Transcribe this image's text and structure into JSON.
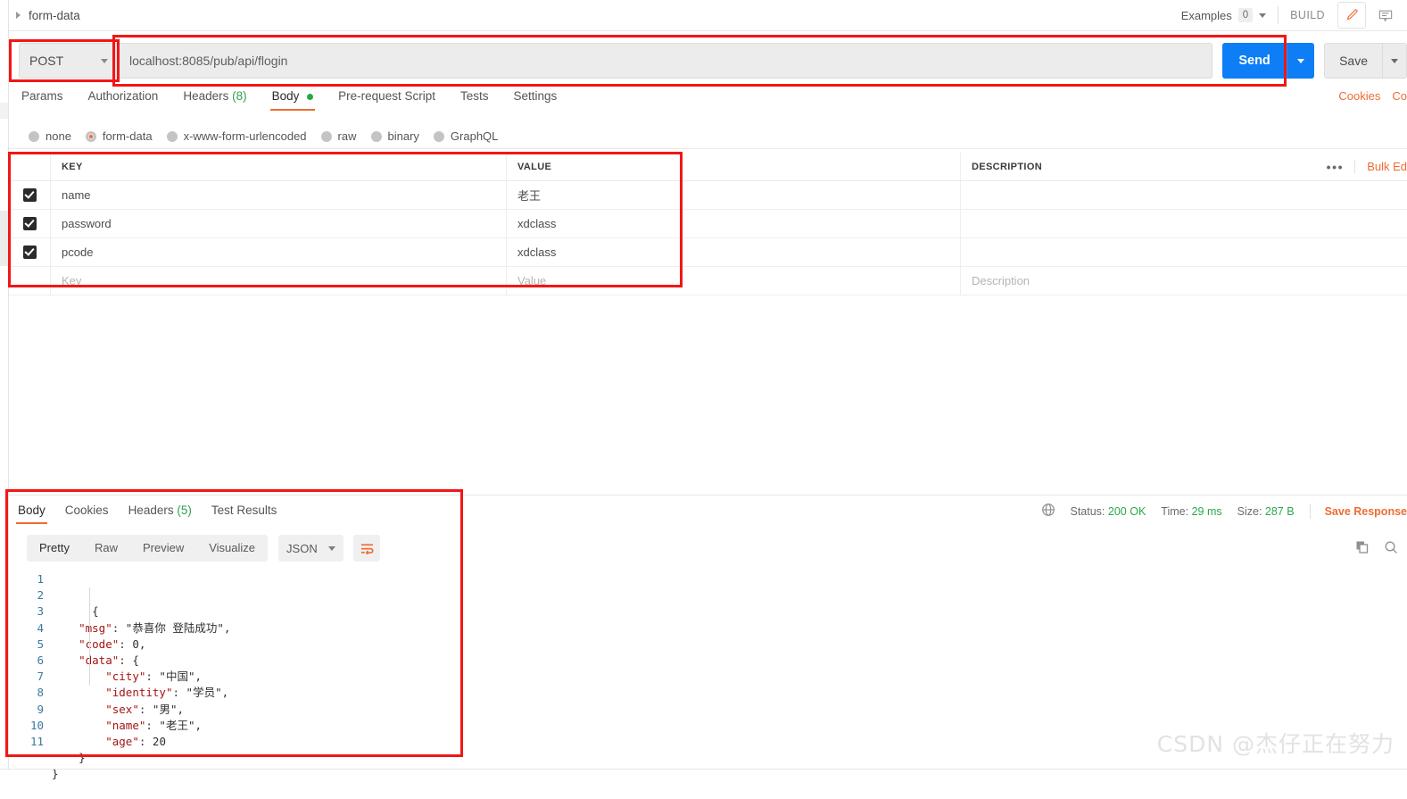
{
  "breadcrumb": {
    "label": "form-data",
    "expand_icon": "triangle-right-icon"
  },
  "topbar": {
    "examples_label": "Examples",
    "examples_count": "0",
    "build_label": "BUILD",
    "edit_icon": "pencil-icon",
    "comment_icon": "comment-icon"
  },
  "request": {
    "method": "POST",
    "url": "localhost:8085/pub/api/flogin",
    "send_label": "Send",
    "save_label": "Save"
  },
  "request_tabs": [
    {
      "label": "Params",
      "suffix": "",
      "active": false
    },
    {
      "label": "Authorization",
      "suffix": "",
      "active": false
    },
    {
      "label": "Headers",
      "suffix": "(8)",
      "active": false
    },
    {
      "label": "Body",
      "suffix": "",
      "active": true,
      "dot": true
    },
    {
      "label": "Pre-request Script",
      "suffix": "",
      "active": false
    },
    {
      "label": "Tests",
      "suffix": "",
      "active": false
    },
    {
      "label": "Settings",
      "suffix": "",
      "active": false
    }
  ],
  "tabs_right_links": [
    "Cookies",
    "Co"
  ],
  "body_types": [
    {
      "label": "none",
      "selected": false
    },
    {
      "label": "form-data",
      "selected": true
    },
    {
      "label": "x-www-form-urlencoded",
      "selected": false
    },
    {
      "label": "raw",
      "selected": false
    },
    {
      "label": "binary",
      "selected": false
    },
    {
      "label": "GraphQL",
      "selected": false
    }
  ],
  "kv_table": {
    "headers": {
      "key": "KEY",
      "value": "VALUE",
      "description": "DESCRIPTION"
    },
    "tools": {
      "more_label": "•••",
      "bulk_edit_label": "Bulk Ed"
    },
    "rows": [
      {
        "checked": true,
        "key": "name",
        "value": "老王",
        "description": ""
      },
      {
        "checked": true,
        "key": "password",
        "value": "xdclass",
        "description": ""
      },
      {
        "checked": true,
        "key": "pcode",
        "value": "xdclass",
        "description": ""
      }
    ],
    "placeholder_row": {
      "key": "Key",
      "value": "Value",
      "description": "Description"
    }
  },
  "response_tabs": [
    {
      "label": "Body",
      "suffix": "",
      "active": true
    },
    {
      "label": "Cookies",
      "suffix": "",
      "active": false
    },
    {
      "label": "Headers",
      "suffix": "(5)",
      "active": false
    },
    {
      "label": "Test Results",
      "suffix": "",
      "active": false
    }
  ],
  "status": {
    "globe_icon": "globe-icon",
    "status_label": "Status:",
    "status_value": "200 OK",
    "time_label": "Time:",
    "time_value": "29 ms",
    "size_label": "Size:",
    "size_value": "287 B",
    "save_response_label": "Save Response"
  },
  "format_bar": {
    "modes": [
      {
        "label": "Pretty",
        "active": true
      },
      {
        "label": "Raw",
        "active": false
      },
      {
        "label": "Preview",
        "active": false
      },
      {
        "label": "Visualize",
        "active": false
      }
    ],
    "language": "JSON",
    "wrap_icon": "wrap-lines-icon",
    "copy_icon": "copy-icon",
    "search_icon": "search-icon"
  },
  "response_body": {
    "line_numbers": [
      "1",
      "2",
      "3",
      "4",
      "5",
      "6",
      "7",
      "8",
      "9",
      "10",
      "11"
    ],
    "json_text": "{\n    \"msg\": \"恭喜你 登陆成功\",\n    \"code\": 0,\n    \"data\": {\n        \"city\": \"中国\",\n        \"identity\": \"学员\",\n        \"sex\": \"男\",\n        \"name\": \"老王\",\n        \"age\": 20\n    }\n}",
    "parsed": {
      "msg": "恭喜你 登陆成功",
      "code": 0,
      "data": {
        "city": "中国",
        "identity": "学员",
        "sex": "男",
        "name": "老王",
        "age": 20
      }
    }
  },
  "watermark": "CSDN @杰仔正在努力",
  "colors": {
    "accent_orange": "#ef6c33",
    "send_blue": "#0d7ef5",
    "status_green": "#2aa84a",
    "annotation_red": "#f21616"
  }
}
